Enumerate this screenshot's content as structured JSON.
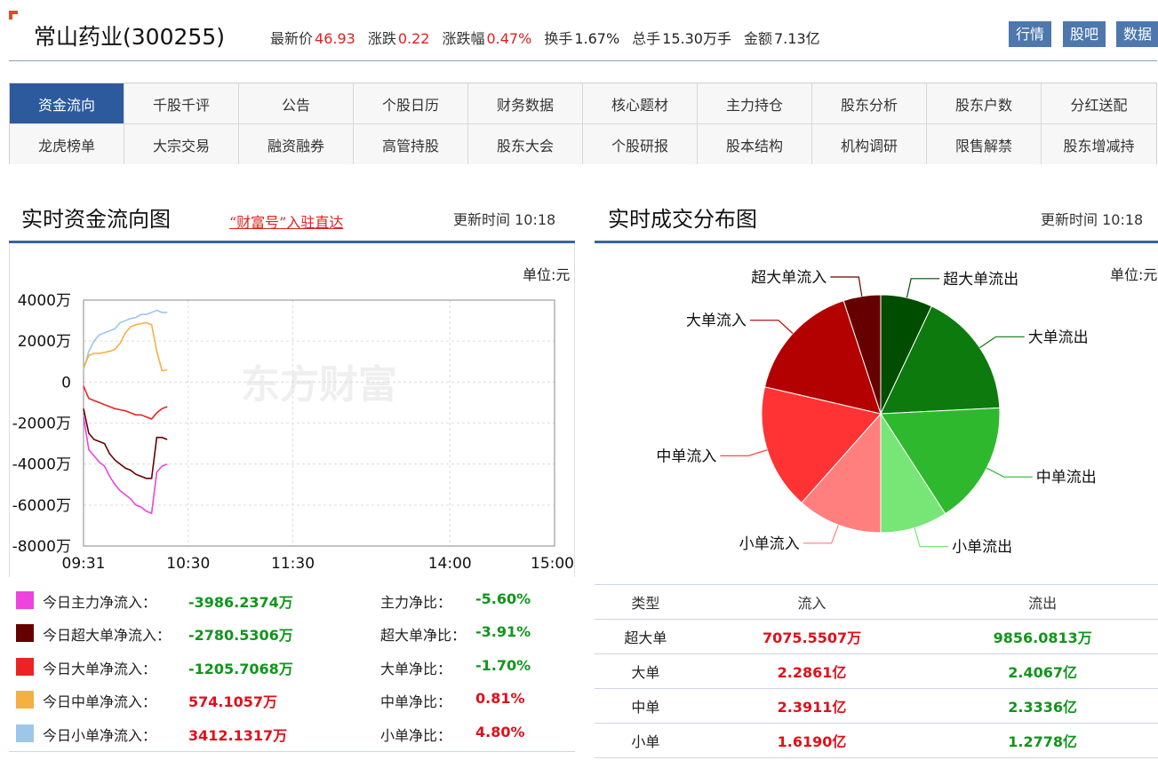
{
  "header": {
    "stock_title": "常山药业(300255)",
    "quotes": [
      {
        "label": "最新价",
        "value": "46.93",
        "color": "red"
      },
      {
        "label": "涨跌",
        "value": "0.22",
        "color": "red"
      },
      {
        "label": "涨跌幅",
        "value": "0.47%",
        "color": "red"
      },
      {
        "label": "换手",
        "value": "1.67%",
        "color": "black"
      },
      {
        "label": "总手",
        "value": "15.30万手",
        "color": "black"
      },
      {
        "label": "金额",
        "value": "7.13亿",
        "color": "black"
      }
    ],
    "buttons": [
      "行情",
      "股吧",
      "数据"
    ]
  },
  "nav": {
    "row1": [
      "资金流向",
      "千股千评",
      "公告",
      "个股日历",
      "财务数据",
      "核心题材",
      "主力持仓",
      "股东分析",
      "股东户数",
      "分红送配"
    ],
    "row2": [
      "龙虎榜单",
      "大宗交易",
      "融资融券",
      "高管持股",
      "股东大会",
      "个股研报",
      "股本结构",
      "机构调研",
      "限售解禁",
      "股东增减持"
    ],
    "active": "资金流向"
  },
  "flow_section": {
    "title": "实时资金流向图",
    "link": "“财富号”入驻直达",
    "update_label": "更新时间",
    "update_time": "10:18",
    "unit": "单位:元",
    "watermark": "东方财富"
  },
  "dist_section": {
    "title": "实时成交分布图",
    "update_label": "更新时间",
    "update_time": "10:18",
    "unit": "单位:元"
  },
  "legend": [
    {
      "label": "今日主力净流入：",
      "value": "-3986.2374万",
      "ratio_label": "主力净比：",
      "ratio": "-5.60%",
      "color": "#ee44dd",
      "value_color": "green",
      "ratio_color": "green"
    },
    {
      "label": "今日超大单净流入：",
      "value": "-2780.5306万",
      "ratio_label": "超大单净比：",
      "ratio": "-3.91%",
      "color": "#660000",
      "value_color": "green",
      "ratio_color": "green"
    },
    {
      "label": "今日大单净流入：",
      "value": "-1205.7068万",
      "ratio_label": "大单净比：",
      "ratio": "-1.70%",
      "color": "#ee2222",
      "value_color": "green",
      "ratio_color": "green"
    },
    {
      "label": "今日中单净流入：",
      "value": "574.1057万",
      "ratio_label": "中单净比：",
      "ratio": "0.81%",
      "color": "#f5b041",
      "value_color": "red",
      "ratio_color": "red"
    },
    {
      "label": "今日小单净流入：",
      "value": "3412.1317万",
      "ratio_label": "小单净比：",
      "ratio": "4.80%",
      "color": "#9ec6ea",
      "value_color": "red",
      "ratio_color": "red"
    }
  ],
  "table": {
    "headers": [
      "类型",
      "流入",
      "流出"
    ],
    "rows": [
      {
        "type": "超大单",
        "in": "7075.5507万",
        "out": "9856.0813万"
      },
      {
        "type": "大单",
        "in": "2.2861亿",
        "out": "2.4067亿"
      },
      {
        "type": "中单",
        "in": "2.3911亿",
        "out": "2.3336亿"
      },
      {
        "type": "小单",
        "in": "1.6190亿",
        "out": "1.2778亿"
      }
    ]
  },
  "chart_data": [
    {
      "type": "line",
      "ylim": [
        -8000,
        4000
      ],
      "yticks": [
        4000,
        2000,
        0,
        -2000,
        -4000,
        -6000,
        -8000
      ],
      "ytick_labels": [
        "4000万",
        "2000万",
        "0",
        "-2000万",
        "-4000万",
        "-6000万",
        "-8000万"
      ],
      "xtick_labels": [
        "09:31",
        "10:30",
        "11:30",
        "14:00",
        "15:00"
      ],
      "xticks": [
        0,
        60,
        120,
        210,
        270
      ],
      "grid": true,
      "series": [
        {
          "key": "small",
          "color": "#9ec6ea",
          "x": [
            0,
            3,
            6,
            9,
            12,
            15,
            18,
            21,
            24,
            27,
            30,
            33,
            36,
            39,
            42,
            45,
            48
          ],
          "values": [
            600,
            1500,
            2000,
            2300,
            2400,
            2500,
            2600,
            2900,
            3000,
            3100,
            3150,
            3300,
            3300,
            3400,
            3500,
            3400,
            3400
          ]
        },
        {
          "key": "medium",
          "color": "#f5b041",
          "x": [
            0,
            3,
            6,
            9,
            12,
            15,
            18,
            21,
            24,
            27,
            30,
            33,
            36,
            39,
            42,
            45,
            48
          ],
          "values": [
            700,
            1300,
            1400,
            1400,
            1450,
            1500,
            1600,
            1900,
            2400,
            2700,
            2800,
            2850,
            2900,
            2800,
            1500,
            550,
            600
          ]
        },
        {
          "key": "large",
          "color": "#ee2222",
          "x": [
            0,
            3,
            6,
            9,
            12,
            15,
            18,
            21,
            24,
            27,
            30,
            33,
            36,
            39,
            42,
            45,
            48
          ],
          "values": [
            -200,
            -800,
            -900,
            -1000,
            -1100,
            -1200,
            -1300,
            -1350,
            -1400,
            -1500,
            -1600,
            -1600,
            -1700,
            -1800,
            -1500,
            -1300,
            -1200
          ]
        },
        {
          "key": "super_large",
          "color": "#660000",
          "x": [
            0,
            3,
            6,
            9,
            12,
            15,
            18,
            21,
            24,
            27,
            30,
            33,
            36,
            39,
            42,
            45,
            48
          ],
          "values": [
            -1300,
            -2500,
            -2800,
            -2900,
            -3000,
            -3500,
            -3800,
            -4000,
            -4200,
            -4300,
            -4500,
            -4600,
            -4700,
            -4700,
            -2700,
            -2700,
            -2800
          ]
        },
        {
          "key": "main",
          "color": "#ee44dd",
          "x": [
            0,
            3,
            6,
            9,
            12,
            15,
            18,
            21,
            24,
            27,
            30,
            33,
            36,
            39,
            42,
            45,
            48
          ],
          "values": [
            -1700,
            -3300,
            -3600,
            -3900,
            -4100,
            -4600,
            -5000,
            -5300,
            -5500,
            -5700,
            -6000,
            -6100,
            -6300,
            -6400,
            -4400,
            -4100,
            -4000
          ]
        }
      ]
    },
    {
      "type": "pie",
      "slices": [
        {
          "name": "超大单流出",
          "value": 9856.0813,
          "color": "#004d00",
          "label_side": "right"
        },
        {
          "name": "大单流出",
          "value": 24067,
          "color": "#0d7a0d",
          "label_side": "right"
        },
        {
          "name": "中单流出",
          "value": 23336,
          "color": "#2eb82e",
          "label_side": "right"
        },
        {
          "name": "小单流出",
          "value": 12778,
          "color": "#77e677",
          "label_side": "right"
        },
        {
          "name": "小单流入",
          "value": 16190,
          "color": "#ff7f7f",
          "label_side": "left"
        },
        {
          "name": "中单流入",
          "value": 23911,
          "color": "#ff3333",
          "label_side": "left"
        },
        {
          "name": "大单流入",
          "value": 22861,
          "color": "#b30000",
          "label_side": "left"
        },
        {
          "name": "超大单流入",
          "value": 7075.5507,
          "color": "#660000",
          "label_side": "left"
        }
      ]
    }
  ]
}
